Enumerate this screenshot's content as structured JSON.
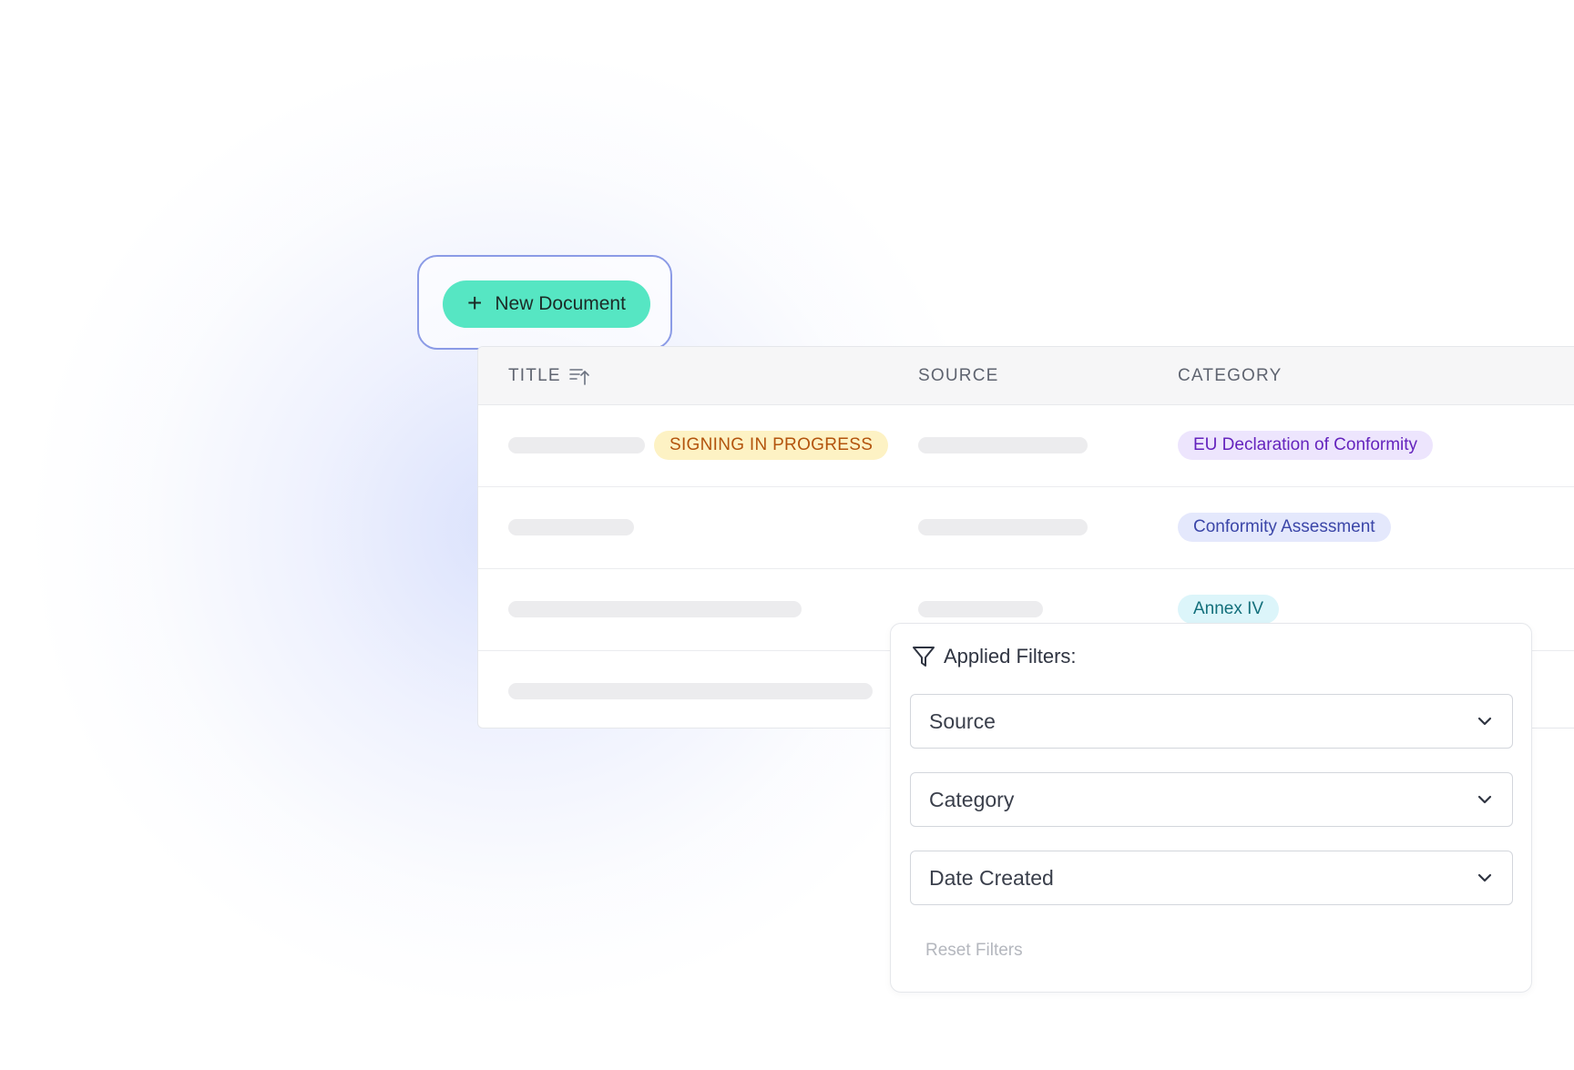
{
  "toolbar": {
    "new_document_label": "New Document",
    "plus_icon": "+"
  },
  "table": {
    "columns": {
      "title": "TITLE",
      "source": "SOURCE",
      "category": "CATEGORY"
    },
    "rows": [
      {
        "status": "SIGNING IN PROGRESS",
        "category": "EU Declaration of Conformity"
      },
      {
        "category": "Conformity Assessment"
      },
      {
        "category": "Annex IV"
      },
      {}
    ]
  },
  "filters": {
    "heading": "Applied Filters:",
    "source_label": "Source",
    "category_label": "Category",
    "date_created_label": "Date Created",
    "reset_label": "Reset Filters"
  },
  "colors": {
    "accent_button": "#56e6c3",
    "status_yellow_bg": "#fdf2c4",
    "status_yellow_text": "#b3540d",
    "category_purple": "#6423bd",
    "category_indigo": "#3b46a8",
    "category_cyan": "#126f7b"
  }
}
